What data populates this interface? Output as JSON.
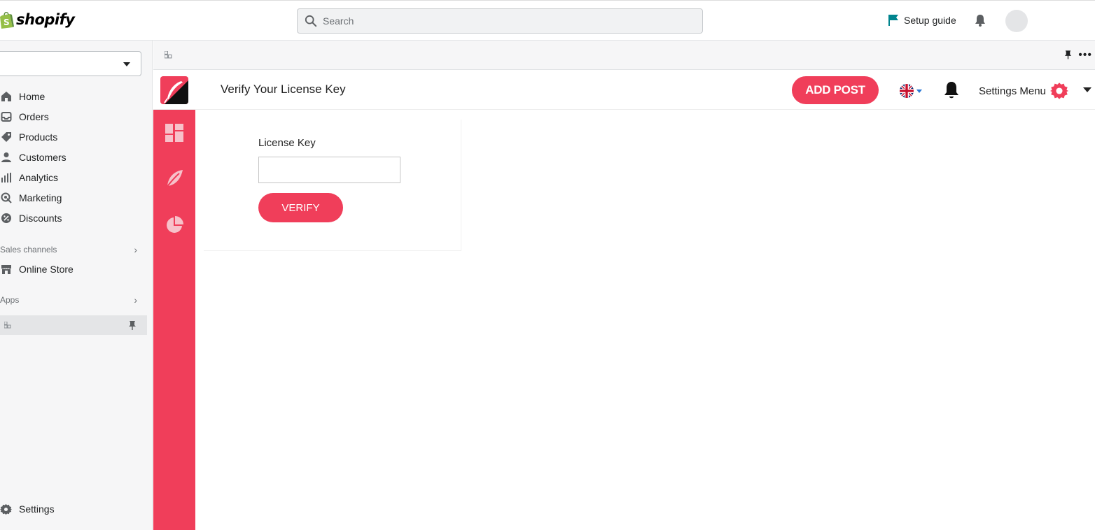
{
  "topbar": {
    "logo_text": "shopify",
    "search_placeholder": "Search",
    "setup_guide": "Setup guide"
  },
  "nav": {
    "items": [
      {
        "label": "Home",
        "icon": "home-icon"
      },
      {
        "label": "Orders",
        "icon": "inbox-icon"
      },
      {
        "label": "Products",
        "icon": "tag-icon"
      },
      {
        "label": "Customers",
        "icon": "person-icon"
      },
      {
        "label": "Analytics",
        "icon": "bar-chart-icon"
      },
      {
        "label": "Marketing",
        "icon": "target-icon"
      },
      {
        "label": "Discounts",
        "icon": "discount-icon"
      }
    ],
    "sales_channels": "Sales channels",
    "online_store": "Online Store",
    "apps": "Apps",
    "settings": "Settings"
  },
  "app": {
    "title": "Verify Your License Key",
    "add_post": "ADD POST",
    "settings_menu": "Settings Menu",
    "license_label": "License Key",
    "license_value": "",
    "verify": "VERIFY"
  },
  "colors": {
    "brand_red": "#f03e5a",
    "shopify_green": "#95bf47",
    "flag_teal": "#00848e"
  }
}
